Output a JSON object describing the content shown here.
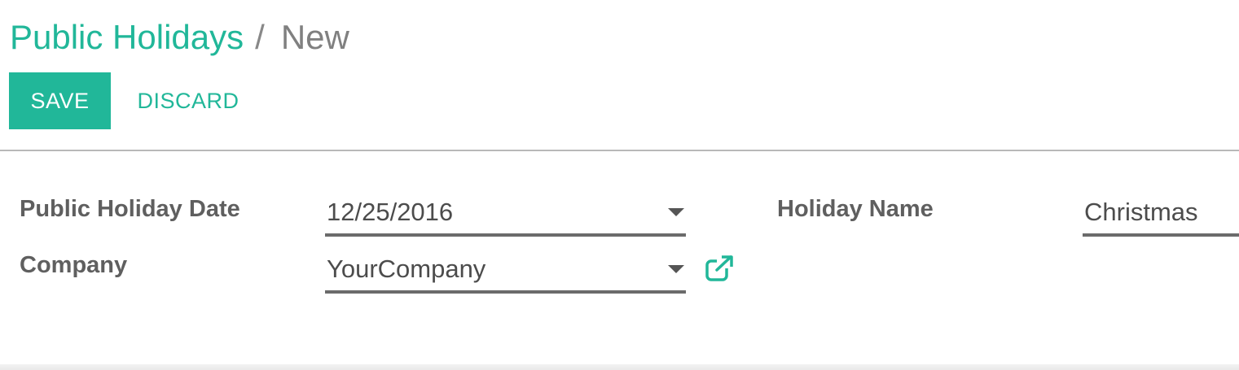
{
  "breadcrumb": {
    "parent": "Public Holidays",
    "separator": "/",
    "current": "New"
  },
  "toolbar": {
    "save_label": "SAVE",
    "discard_label": "DISCARD"
  },
  "form": {
    "public_holiday_date": {
      "label": "Public Holiday Date",
      "value": "12/25/2016"
    },
    "company": {
      "label": "Company",
      "value": "YourCompany"
    },
    "holiday_name": {
      "label": "Holiday Name",
      "value": "Christmas"
    }
  },
  "colors": {
    "accent": "#21b799",
    "label": "#5f5f5f",
    "input_border": "#6b6b6b"
  },
  "icons": {
    "date_dropdown": "caret-down-icon",
    "company_dropdown": "caret-down-icon",
    "company_link": "external-link-icon"
  }
}
